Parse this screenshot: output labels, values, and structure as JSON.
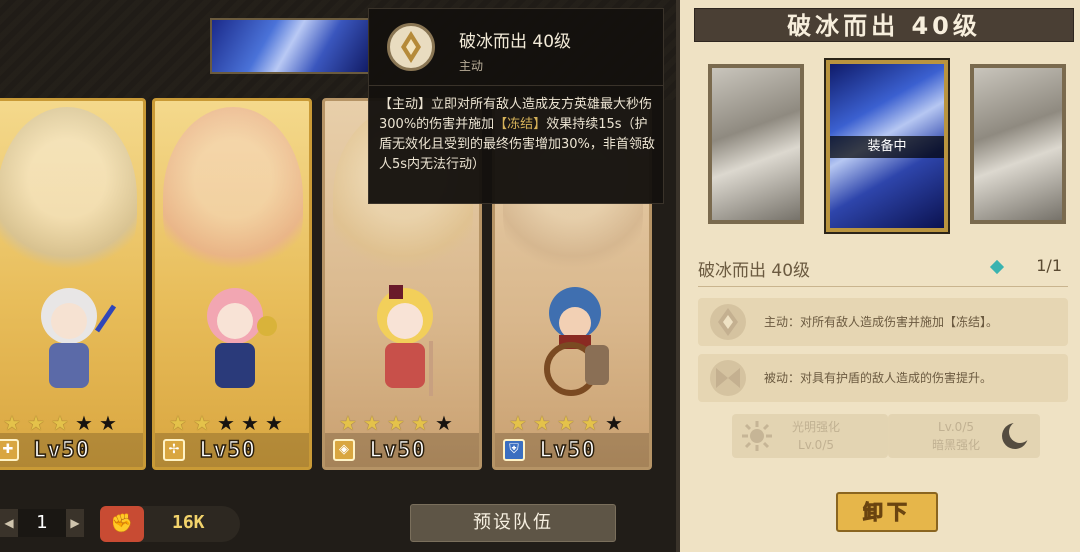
{
  "tooltip": {
    "icon": "skill-rune-icon",
    "title": "破冰而出 40级",
    "type": "主动",
    "desc_prefix": "【主动】立即对所有敌人造成友方英雄最大秒伤300%的伤害并施加",
    "desc_highlight": "【冻结】",
    "desc_suffix": "效果持续15s（护盾无效化且受到的最终伤害增加30%，非首领敌人5s内无法行动）"
  },
  "heroes": [
    {
      "stars_on": 3,
      "stars_off": 2,
      "level": "Lv50",
      "role_icon": "support-icon"
    },
    {
      "stars_on": 2,
      "stars_off": 3,
      "level": "Lv50",
      "role_icon": "healer-icon"
    },
    {
      "stars_on": 4,
      "stars_off": 1,
      "level": "Lv50",
      "role_icon": "mage-icon"
    },
    {
      "stars_on": 4,
      "stars_off": 1,
      "level": "Lv50",
      "role_icon": "shield-icon"
    }
  ],
  "bottom": {
    "page": "1",
    "power": "16K",
    "preset_label": "预设队伍"
  },
  "panel": {
    "title": "破冰而出 40级",
    "equipped_label": "装备中",
    "skill_name": "破冰而出 40级",
    "count": "1/1",
    "effects": [
      {
        "icon": "rune-active-icon",
        "text": "主动：对所有敌人造成伤害并施加【冻结】。"
      },
      {
        "icon": "rune-passive-icon",
        "text": "被动：对具有护盾的敌人造成的伤害提升。"
      }
    ],
    "boost_light": {
      "line1": "光明强化",
      "line2": "Lv.0/5"
    },
    "boost_dark": {
      "line1": "Lv.0/5",
      "line2": "暗黑强化"
    },
    "unequip_label": "卸下"
  },
  "colors": {
    "accent": "#e6b64a",
    "star": "#e4c24a",
    "highlight": "#d7b35a"
  }
}
